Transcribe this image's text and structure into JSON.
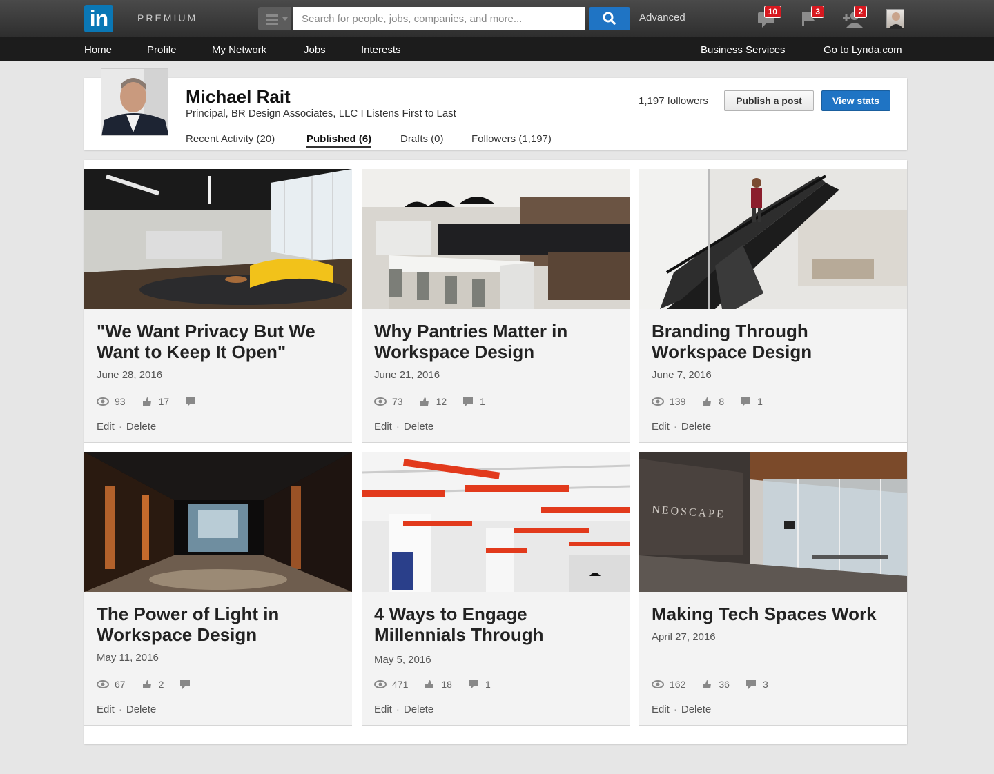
{
  "topbar": {
    "logo": "in",
    "premium": "PREMIUM",
    "search_placeholder": "Search for people, jobs, companies, and more...",
    "advanced": "Advanced",
    "messages_badge": "10",
    "notifications_badge": "3",
    "invitations_badge": "2"
  },
  "nav": {
    "home": "Home",
    "profile": "Profile",
    "network": "My Network",
    "jobs": "Jobs",
    "interests": "Interests",
    "business": "Business Services",
    "lynda": "Go to Lynda.com"
  },
  "profile": {
    "name": "Michael Rait",
    "headline": "Principal, BR Design Associates, LLC I Listens First to Last",
    "followers": "1,197 followers",
    "publish_label": "Publish a post",
    "stats_label": "View stats"
  },
  "tabs": {
    "recent": "Recent Activity (20)",
    "published": "Published (6)",
    "drafts": "Drafts (0)",
    "followers": "Followers (1,197)"
  },
  "posts": [
    {
      "title": "\"We Want Privacy But We Want to Keep It Open\"",
      "date": "June 28, 2016",
      "views": "93",
      "likes": "17",
      "comments": "",
      "edit": "Edit",
      "delete": "Delete"
    },
    {
      "title": "Why Pantries Matter in Workspace Design",
      "date": "June 21, 2016",
      "views": "73",
      "likes": "12",
      "comments": "1",
      "edit": "Edit",
      "delete": "Delete"
    },
    {
      "title": "Branding Through Workspace Design",
      "date": "June 7, 2016",
      "views": "139",
      "likes": "8",
      "comments": "1",
      "edit": "Edit",
      "delete": "Delete"
    },
    {
      "title": "The Power of Light in Workspace Design",
      "date": "May 11, 2016",
      "views": "67",
      "likes": "2",
      "comments": "",
      "edit": "Edit",
      "delete": "Delete"
    },
    {
      "title": "4 Ways to Engage Millennials Through",
      "date": "May 5, 2016",
      "views": "471",
      "likes": "18",
      "comments": "1",
      "edit": "Edit",
      "delete": "Delete"
    },
    {
      "title": "Making Tech Spaces Work",
      "date": "April 27, 2016",
      "views": "162",
      "likes": "36",
      "comments": "3",
      "edit": "Edit",
      "delete": "Delete"
    }
  ],
  "image_texts": {
    "neoscape": "NEOSCAPE"
  },
  "colors": {
    "linkedin_blue": "#0a77b5",
    "primary_button": "#1f74c4",
    "badge_red": "#d71920"
  }
}
